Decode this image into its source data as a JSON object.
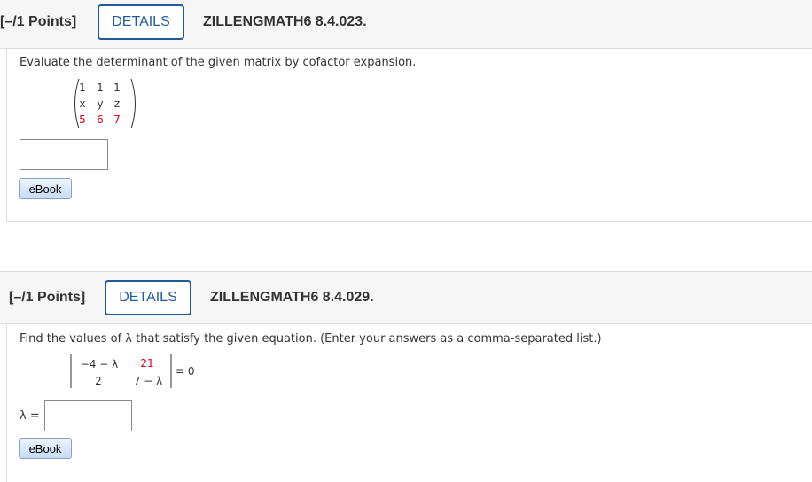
{
  "q1": {
    "points": "[–/1 Points]",
    "details_label": "DETAILS",
    "reference": "ZILLENGMATH6 8.4.023.",
    "prompt": "Evaluate the determinant of the given matrix by cofactor expansion.",
    "matrix": [
      [
        "1",
        "1",
        "1"
      ],
      [
        "x",
        "y",
        "z"
      ],
      [
        "5",
        "6",
        "7"
      ]
    ],
    "ebook_label": "eBook"
  },
  "q2": {
    "points": "[–/1 Points]",
    "details_label": "DETAILS",
    "reference": "ZILLENGMATH6 8.4.029.",
    "prompt": "Find the values of λ that satisfy the given equation. (Enter your answers as a comma-separated list.)",
    "det": [
      [
        "−4 − λ",
        "21"
      ],
      [
        "2",
        "7 − λ"
      ]
    ],
    "equals": "= 0",
    "answer_label": "λ =",
    "ebook_label": "eBook"
  },
  "colors": {
    "accent": "#1f5c99",
    "highlight": "#d0021b"
  }
}
